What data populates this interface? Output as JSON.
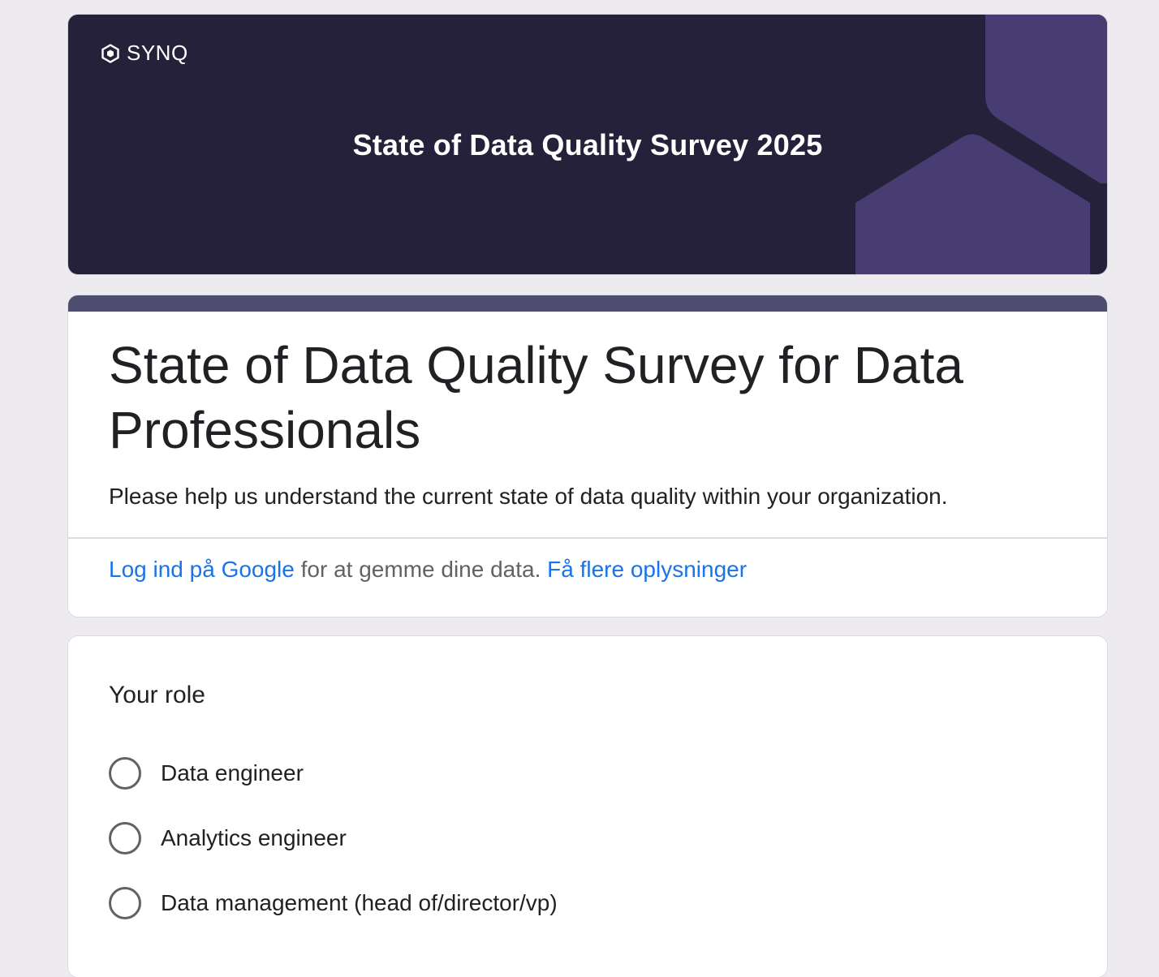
{
  "banner": {
    "brand": "SYNQ",
    "title": "State of Data Quality Survey 2025",
    "colors": {
      "background": "#26213b",
      "decoration": "#483d72"
    }
  },
  "form": {
    "title": "State of Data Quality Survey for Data Professionals",
    "description": "Please help us understand the current state of data quality within your organization.",
    "accent_color": "#4e4d6f",
    "signin": {
      "link_text": "Log ind på Google",
      "middle_text": " for at gemme dine data. ",
      "more_link": "Få flere oplysninger"
    }
  },
  "question": {
    "title": "Your role",
    "options": [
      {
        "label": "Data engineer",
        "selected": false
      },
      {
        "label": "Analytics engineer",
        "selected": false
      },
      {
        "label": "Data management (head of/director/vp)",
        "selected": false
      }
    ]
  }
}
